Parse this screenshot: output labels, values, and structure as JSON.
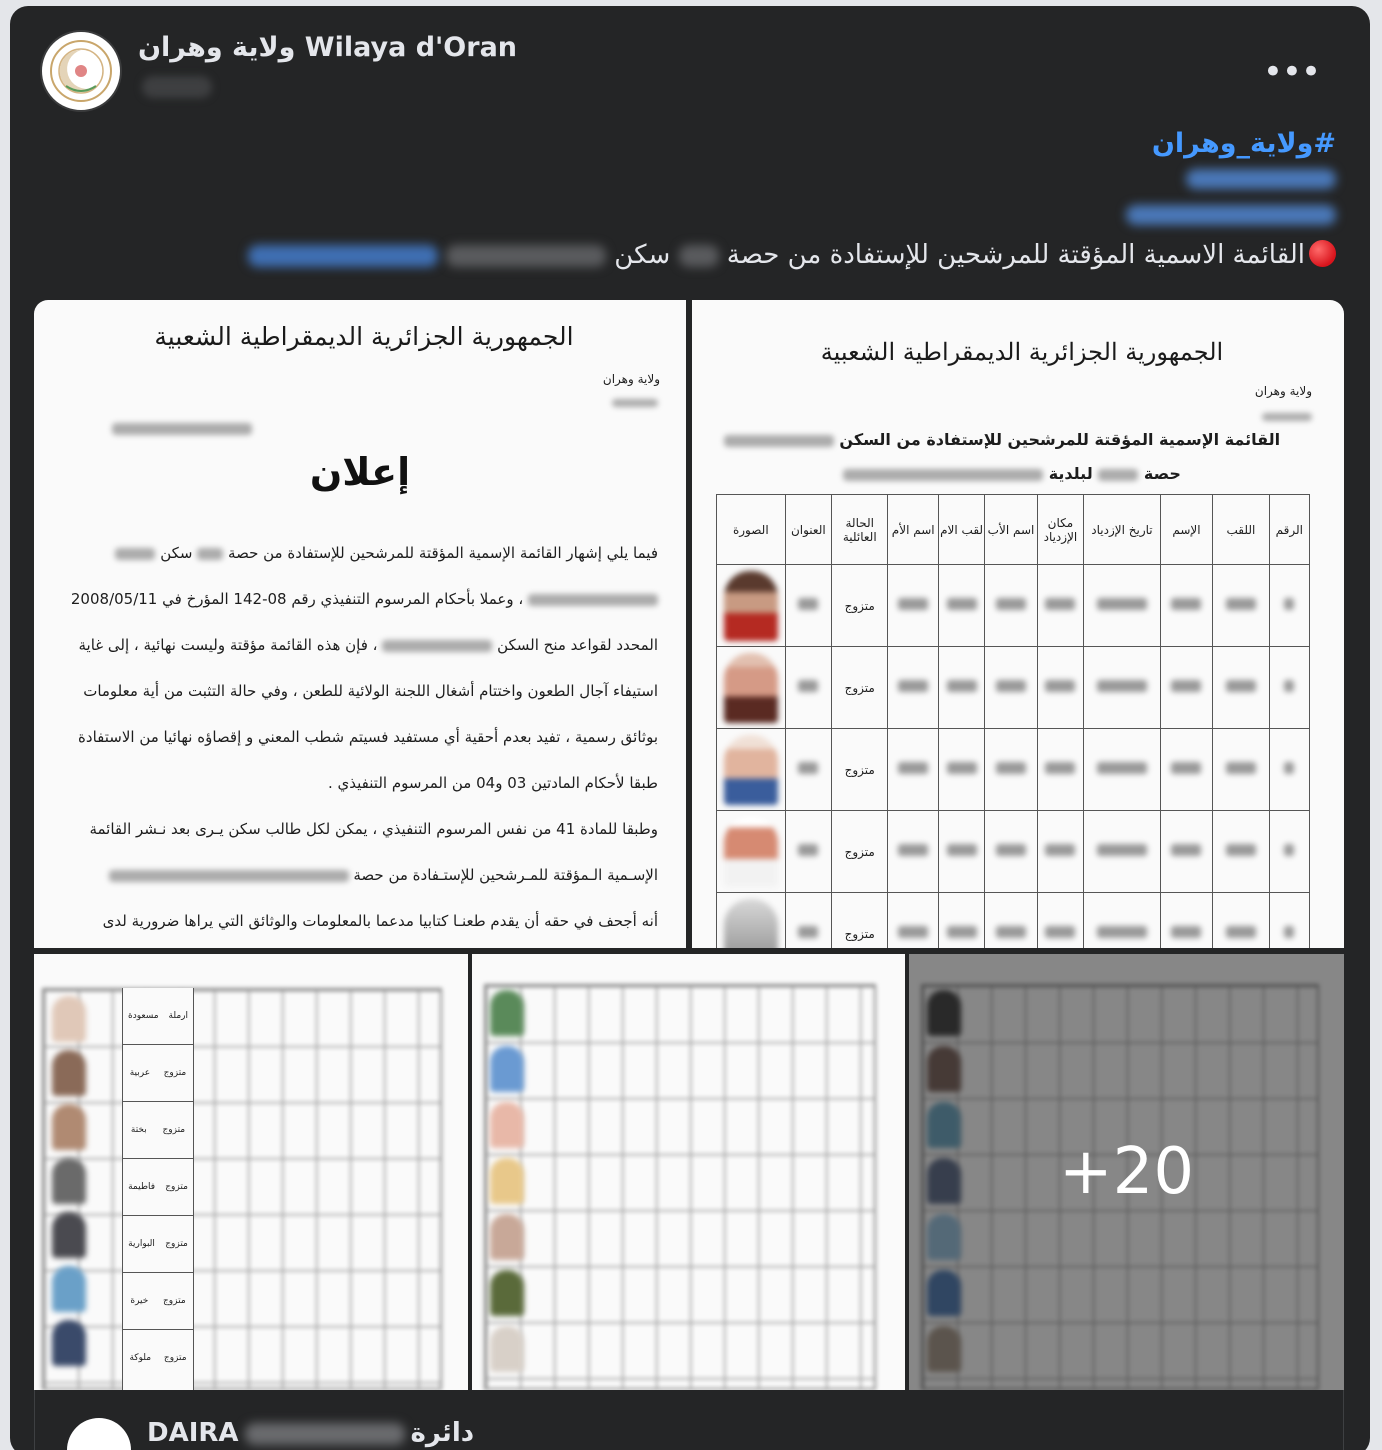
{
  "header": {
    "page_name": "ولاية وهران Wilaya d'Oran",
    "more_label": "•••"
  },
  "caption": {
    "hashtag": "#ولاية_وهران",
    "line_text": "القائمة الاسمية  المؤقتة للمرشحين للإستفادة من حصة",
    "line_unit": "سكن"
  },
  "doc1": {
    "head": "الجمهورية الجزائرية الديمقراطية الشعبية",
    "wilaya": "ولاية وهران",
    "title": "إعلان",
    "p1": "فيما يلي إشهار القائمة الإسمية المؤقتة للمرشحين للإستفادة من حصة",
    "p1b": "سكن",
    "p2": "، وعملا بأحكام المرسوم التنفيذي رقم 08-142 المؤرخ في 2008/05/11",
    "p3": "المحدد لقواعد منح السكن",
    "p3b": "، فإن هذه القائمة مؤقتة وليست نهائية ، إلى غاية",
    "p4": "استيفاء آجال الطعون واختتام أشغال اللجنة الولائية للطعن ، وفي حالة التثبت من أية معلومات",
    "p5": "بوثائق رسمية ، تفيد بعدم أحقية أي مستفيد فسيتم شطب المعني و إقصاؤه نهائيا من الاستفادة",
    "p6": "طبقا لأحكام المادتين 03 و04 من المرسوم التنفيذي .",
    "p7": "وطبقا للمادة 41 من نفس المرسوم التنفيذي ، يمكن لكل طالب سكن يـرى بعد نـشر القائمة",
    "p8": "الإسـمية الـمؤقتة للمـرشحين للإستـفادة من حصة",
    "p9": "أنه أجحف في حقه أن يقدم طعنـا كتابيا مدعما بالمعلومات والوثائق التي يراها ضرورية لدى"
  },
  "doc2": {
    "head": "الجمهورية الجزائرية الديمقراطية الشعبية",
    "wilaya": "ولاية وهران",
    "title1": "القائمة الإسمية المؤقتة للمرشحين للإستفادة من السكن",
    "title2a": "حصة",
    "title2b": "لبلدية",
    "columns": [
      "الرقم",
      "اللقب",
      "الإسم",
      "تاريخ الإزدياد",
      "مكان الإزدياد",
      "اسم الأب",
      "لقب الام",
      "اسم الأم",
      "الحالة العائلية",
      "العنوان",
      "الصورة"
    ],
    "status": [
      "متزوج",
      "متزوج",
      "متزوج",
      "متزوج",
      "متزوج"
    ]
  },
  "doc3": {
    "mothers": [
      "مسعودة",
      "عربية",
      "بختة",
      "فاطيمة",
      "البوارية",
      "خيرة",
      "ملوكة"
    ],
    "status": [
      "ارملة",
      "متزوج",
      "متزوج",
      "متزوج",
      "متزوج",
      "متزوج",
      "متزوج"
    ]
  },
  "gallery": {
    "more_count": "+20"
  },
  "shared": {
    "name_a": "DAIRA",
    "name_b": "دائرة"
  },
  "colors": {
    "card_bg": "#242526",
    "text": "#e4e6eb",
    "link": "#4599ff",
    "red_dot": "#e41e24"
  }
}
